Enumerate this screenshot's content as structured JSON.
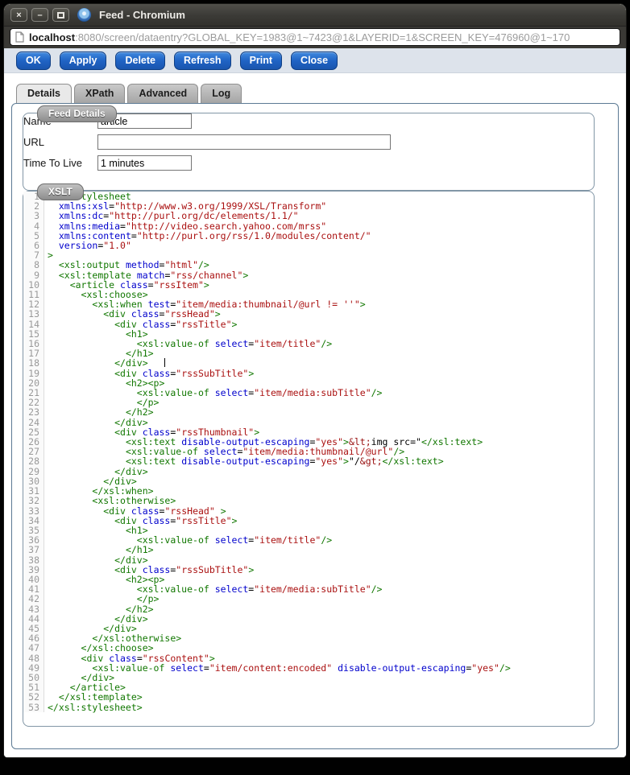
{
  "window": {
    "title": "Feed - Chromium"
  },
  "icons": {
    "close": "×",
    "minimize": "–"
  },
  "urlbar": {
    "host": "localhost",
    "rest": ":8080/screen/dataentry?GLOBAL_KEY=1983@1~7423@1&LAYERID=1&SCREEN_KEY=476960@1~170"
  },
  "toolbar": {
    "buttons": [
      "OK",
      "Apply",
      "Delete",
      "Refresh",
      "Print",
      "Close"
    ]
  },
  "tabs": [
    {
      "label": "Details",
      "active": true
    },
    {
      "label": "XPath",
      "active": false
    },
    {
      "label": "Advanced",
      "active": false
    },
    {
      "label": "Log",
      "active": false
    }
  ],
  "feed_details": {
    "legend": "Feed Details",
    "fields": [
      {
        "label": "Name",
        "value": "article"
      },
      {
        "label": "URL",
        "value": ""
      },
      {
        "label": "Time To Live",
        "value": "1 minutes"
      }
    ]
  },
  "xslt": {
    "legend": "XSLT",
    "lines": [
      [
        [
          "t",
          "<xsl:stylesheet"
        ]
      ],
      [
        [
          "p",
          "  "
        ],
        [
          "a",
          "xmlns:xsl"
        ],
        [
          "p",
          "="
        ],
        [
          "s",
          "\"http://www.w3.org/1999/XSL/Transform\""
        ]
      ],
      [
        [
          "p",
          "  "
        ],
        [
          "a",
          "xmlns:dc"
        ],
        [
          "p",
          "="
        ],
        [
          "s",
          "\"http://purl.org/dc/elements/1.1/\""
        ]
      ],
      [
        [
          "p",
          "  "
        ],
        [
          "a",
          "xmlns:media"
        ],
        [
          "p",
          "="
        ],
        [
          "s",
          "\"http://video.search.yahoo.com/mrss\""
        ]
      ],
      [
        [
          "p",
          "  "
        ],
        [
          "a",
          "xmlns:content"
        ],
        [
          "p",
          "="
        ],
        [
          "s",
          "\"http://purl.org/rss/1.0/modules/content/\""
        ]
      ],
      [
        [
          "p",
          "  "
        ],
        [
          "a",
          "version"
        ],
        [
          "p",
          "="
        ],
        [
          "s",
          "\"1.0\""
        ]
      ],
      [
        [
          "t",
          ">"
        ]
      ],
      [
        [
          "p",
          "  "
        ],
        [
          "t",
          "<xsl:output"
        ],
        [
          "p",
          " "
        ],
        [
          "a",
          "method"
        ],
        [
          "p",
          "="
        ],
        [
          "s",
          "\"html\""
        ],
        [
          "t",
          "/>"
        ]
      ],
      [
        [
          "p",
          "  "
        ],
        [
          "t",
          "<xsl:template"
        ],
        [
          "p",
          " "
        ],
        [
          "a",
          "match"
        ],
        [
          "p",
          "="
        ],
        [
          "s",
          "\"rss/channel\""
        ],
        [
          "t",
          ">"
        ]
      ],
      [
        [
          "p",
          "    "
        ],
        [
          "t",
          "<article"
        ],
        [
          "p",
          " "
        ],
        [
          "a",
          "class"
        ],
        [
          "p",
          "="
        ],
        [
          "s",
          "\"rssItem\""
        ],
        [
          "t",
          ">"
        ]
      ],
      [
        [
          "p",
          "      "
        ],
        [
          "t",
          "<xsl:choose>"
        ]
      ],
      [
        [
          "p",
          "        "
        ],
        [
          "t",
          "<xsl:when"
        ],
        [
          "p",
          " "
        ],
        [
          "a",
          "test"
        ],
        [
          "p",
          "="
        ],
        [
          "s",
          "\"item/media:thumbnail/@url != ''\""
        ],
        [
          "t",
          ">"
        ]
      ],
      [
        [
          "p",
          "          "
        ],
        [
          "t",
          "<div"
        ],
        [
          "p",
          " "
        ],
        [
          "a",
          "class"
        ],
        [
          "p",
          "="
        ],
        [
          "s",
          "\"rssHead\""
        ],
        [
          "t",
          ">"
        ]
      ],
      [
        [
          "p",
          "            "
        ],
        [
          "t",
          "<div"
        ],
        [
          "p",
          " "
        ],
        [
          "a",
          "class"
        ],
        [
          "p",
          "="
        ],
        [
          "s",
          "\"rssTitle\""
        ],
        [
          "t",
          ">"
        ]
      ],
      [
        [
          "p",
          "              "
        ],
        [
          "t",
          "<h1>"
        ]
      ],
      [
        [
          "p",
          "                "
        ],
        [
          "t",
          "<xsl:value-of"
        ],
        [
          "p",
          " "
        ],
        [
          "a",
          "select"
        ],
        [
          "p",
          "="
        ],
        [
          "s",
          "\"item/title\""
        ],
        [
          "t",
          "/>"
        ]
      ],
      [
        [
          "p",
          "              "
        ],
        [
          "t",
          "</h1>"
        ]
      ],
      [
        [
          "p",
          "            "
        ],
        [
          "t",
          "</div>"
        ],
        [
          "p",
          "   "
        ],
        [
          "c",
          ""
        ]
      ],
      [
        [
          "p",
          "            "
        ],
        [
          "t",
          "<div"
        ],
        [
          "p",
          " "
        ],
        [
          "a",
          "class"
        ],
        [
          "p",
          "="
        ],
        [
          "s",
          "\"rssSubTitle\""
        ],
        [
          "t",
          ">"
        ]
      ],
      [
        [
          "p",
          "              "
        ],
        [
          "t",
          "<h2><p>"
        ]
      ],
      [
        [
          "p",
          "                "
        ],
        [
          "t",
          "<xsl:value-of"
        ],
        [
          "p",
          " "
        ],
        [
          "a",
          "select"
        ],
        [
          "p",
          "="
        ],
        [
          "s",
          "\"item/media:subTitle\""
        ],
        [
          "t",
          "/>"
        ]
      ],
      [
        [
          "p",
          "                "
        ],
        [
          "t",
          "</p>"
        ]
      ],
      [
        [
          "p",
          "              "
        ],
        [
          "t",
          "</h2>"
        ]
      ],
      [
        [
          "p",
          "            "
        ],
        [
          "t",
          "</div>"
        ]
      ],
      [
        [
          "p",
          "            "
        ],
        [
          "t",
          "<div"
        ],
        [
          "p",
          " "
        ],
        [
          "a",
          "class"
        ],
        [
          "p",
          "="
        ],
        [
          "s",
          "\"rssThumbnail\""
        ],
        [
          "t",
          ">"
        ]
      ],
      [
        [
          "p",
          "              "
        ],
        [
          "t",
          "<xsl:text"
        ],
        [
          "p",
          " "
        ],
        [
          "a",
          "disable-output-escaping"
        ],
        [
          "p",
          "="
        ],
        [
          "s",
          "\"yes\""
        ],
        [
          "t",
          ">"
        ],
        [
          "e",
          "&lt;"
        ],
        [
          "p",
          "img src=\""
        ],
        [
          "t",
          "</xsl:text>"
        ]
      ],
      [
        [
          "p",
          "              "
        ],
        [
          "t",
          "<xsl:value-of"
        ],
        [
          "p",
          " "
        ],
        [
          "a",
          "select"
        ],
        [
          "p",
          "="
        ],
        [
          "s",
          "\"item/media:thumbnail/@url\""
        ],
        [
          "t",
          "/>"
        ]
      ],
      [
        [
          "p",
          "              "
        ],
        [
          "t",
          "<xsl:text"
        ],
        [
          "p",
          " "
        ],
        [
          "a",
          "disable-output-escaping"
        ],
        [
          "p",
          "="
        ],
        [
          "s",
          "\"yes\""
        ],
        [
          "t",
          ">"
        ],
        [
          "p",
          "\"/"
        ],
        [
          "e",
          "&gt;"
        ],
        [
          "t",
          "</xsl:text>"
        ]
      ],
      [
        [
          "p",
          "            "
        ],
        [
          "t",
          "</div>"
        ]
      ],
      [
        [
          "p",
          "          "
        ],
        [
          "t",
          "</div>"
        ]
      ],
      [
        [
          "p",
          "        "
        ],
        [
          "t",
          "</xsl:when>"
        ]
      ],
      [
        [
          "p",
          "        "
        ],
        [
          "t",
          "<xsl:otherwise>"
        ]
      ],
      [
        [
          "p",
          "          "
        ],
        [
          "t",
          "<div"
        ],
        [
          "p",
          " "
        ],
        [
          "a",
          "class"
        ],
        [
          "p",
          "="
        ],
        [
          "s",
          "\"rssHead\""
        ],
        [
          "p",
          " "
        ],
        [
          "t",
          ">"
        ]
      ],
      [
        [
          "p",
          "            "
        ],
        [
          "t",
          "<div"
        ],
        [
          "p",
          " "
        ],
        [
          "a",
          "class"
        ],
        [
          "p",
          "="
        ],
        [
          "s",
          "\"rssTitle\""
        ],
        [
          "t",
          ">"
        ]
      ],
      [
        [
          "p",
          "              "
        ],
        [
          "t",
          "<h1>"
        ]
      ],
      [
        [
          "p",
          "                "
        ],
        [
          "t",
          "<xsl:value-of"
        ],
        [
          "p",
          " "
        ],
        [
          "a",
          "select"
        ],
        [
          "p",
          "="
        ],
        [
          "s",
          "\"item/title\""
        ],
        [
          "t",
          "/>"
        ]
      ],
      [
        [
          "p",
          "              "
        ],
        [
          "t",
          "</h1>"
        ]
      ],
      [
        [
          "p",
          "            "
        ],
        [
          "t",
          "</div>"
        ]
      ],
      [
        [
          "p",
          "            "
        ],
        [
          "t",
          "<div"
        ],
        [
          "p",
          " "
        ],
        [
          "a",
          "class"
        ],
        [
          "p",
          "="
        ],
        [
          "s",
          "\"rssSubTitle\""
        ],
        [
          "t",
          ">"
        ]
      ],
      [
        [
          "p",
          "              "
        ],
        [
          "t",
          "<h2><p>"
        ]
      ],
      [
        [
          "p",
          "                "
        ],
        [
          "t",
          "<xsl:value-of"
        ],
        [
          "p",
          " "
        ],
        [
          "a",
          "select"
        ],
        [
          "p",
          "="
        ],
        [
          "s",
          "\"item/media:subTitle\""
        ],
        [
          "t",
          "/>"
        ]
      ],
      [
        [
          "p",
          "                "
        ],
        [
          "t",
          "</p>"
        ]
      ],
      [
        [
          "p",
          "              "
        ],
        [
          "t",
          "</h2>"
        ]
      ],
      [
        [
          "p",
          "            "
        ],
        [
          "t",
          "</div>"
        ]
      ],
      [
        [
          "p",
          "          "
        ],
        [
          "t",
          "</div>"
        ]
      ],
      [
        [
          "p",
          "        "
        ],
        [
          "t",
          "</xsl:otherwise>"
        ]
      ],
      [
        [
          "p",
          "      "
        ],
        [
          "t",
          "</xsl:choose>"
        ]
      ],
      [
        [
          "p",
          "      "
        ],
        [
          "t",
          "<div"
        ],
        [
          "p",
          " "
        ],
        [
          "a",
          "class"
        ],
        [
          "p",
          "="
        ],
        [
          "s",
          "\"rssContent\""
        ],
        [
          "t",
          ">"
        ]
      ],
      [
        [
          "p",
          "        "
        ],
        [
          "t",
          "<xsl:value-of"
        ],
        [
          "p",
          " "
        ],
        [
          "a",
          "select"
        ],
        [
          "p",
          "="
        ],
        [
          "s",
          "\"item/content:encoded\""
        ],
        [
          "p",
          " "
        ],
        [
          "a",
          "disable-output-escaping"
        ],
        [
          "p",
          "="
        ],
        [
          "s",
          "\"yes\""
        ],
        [
          "t",
          "/>"
        ]
      ],
      [
        [
          "p",
          "      "
        ],
        [
          "t",
          "</div>"
        ]
      ],
      [
        [
          "p",
          "    "
        ],
        [
          "t",
          "</article>"
        ]
      ],
      [
        [
          "p",
          "  "
        ],
        [
          "t",
          "</xsl:template>"
        ]
      ],
      [
        [
          "t",
          "</xsl:stylesheet>"
        ]
      ]
    ]
  },
  "colors": {
    "tag": "#117700",
    "attr": "#0000cc",
    "string": "#aa1111",
    "entity": "#991111",
    "plain": "#000000",
    "linenum": "#999999",
    "button": "#2063c4",
    "strip": "#dde3eb",
    "panel_border": "#5c7a94",
    "fieldset_border": "#8296a6",
    "titlebar": "#3b3a36",
    "titlebar_hi": "#504f4a"
  }
}
